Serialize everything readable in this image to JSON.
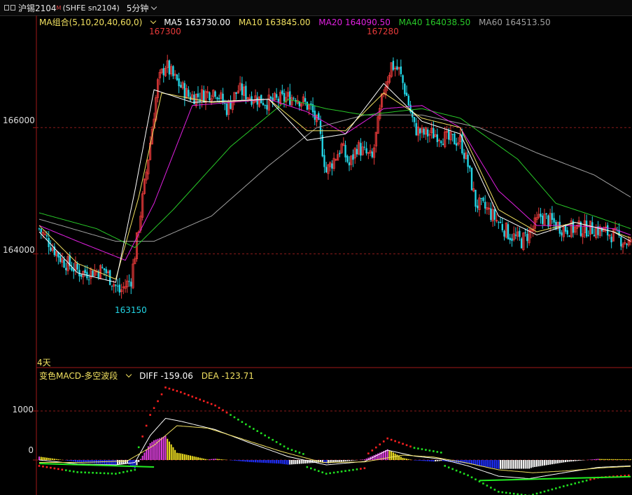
{
  "titlebar": {
    "symbol": "沪锡2104",
    "superscript": "M",
    "code": "(SHFE sn2104)",
    "period": "5分钟",
    "icon": "window-icon"
  },
  "main_legend": {
    "indicator": "MA组合(5,10,20,40,60,0)",
    "ma5": "MA5 163730.00",
    "ma10": "MA10 163845.00",
    "ma20": "MA20 164090.50",
    "ma40": "MA40 164038.50",
    "ma60": "MA60 164513.50"
  },
  "macd_legend": {
    "indicator": "变色MACD-多空波段",
    "diff": "DIFF -159.06",
    "dea": "DEA -123.71"
  },
  "annotations": {
    "high1": "167300",
    "high2": "167280",
    "low1": "163150",
    "days": "4天"
  },
  "colors": {
    "up": "#e83a3a",
    "down": "#22d6e6",
    "ma5": "#ffffff",
    "ma10": "#f0e060",
    "ma20": "#e020e0",
    "ma40": "#28c828",
    "ma60": "#a0a0a0",
    "grid": "#8b1a1a",
    "axis": "#a01818"
  },
  "chart_data": [
    {
      "type": "candlestick",
      "title": "",
      "y_ticks": [
        166000,
        164000
      ],
      "y_tick_labels": [
        "166000",
        "164000"
      ],
      "ylim": [
        162200,
        167600
      ],
      "ma_keypoints": {
        "ma5": [
          [
            0,
            164350
          ],
          [
            20,
            163700
          ],
          [
            40,
            163550
          ],
          [
            50,
            165000
          ],
          [
            60,
            166600
          ],
          [
            80,
            166400
          ],
          [
            120,
            166450
          ],
          [
            140,
            165800
          ],
          [
            160,
            165900
          ],
          [
            180,
            166700
          ],
          [
            200,
            166100
          ],
          [
            220,
            165900
          ],
          [
            240,
            164600
          ],
          [
            260,
            164300
          ],
          [
            280,
            164500
          ],
          [
            300,
            164350
          ],
          [
            309,
            164200
          ]
        ],
        "ma10": [
          [
            0,
            164450
          ],
          [
            20,
            163850
          ],
          [
            40,
            163600
          ],
          [
            52,
            164900
          ],
          [
            64,
            166550
          ],
          [
            90,
            166400
          ],
          [
            120,
            166450
          ],
          [
            140,
            165950
          ],
          [
            160,
            165950
          ],
          [
            180,
            166550
          ],
          [
            200,
            166150
          ],
          [
            220,
            166000
          ],
          [
            240,
            164700
          ],
          [
            260,
            164350
          ],
          [
            280,
            164500
          ],
          [
            300,
            164350
          ],
          [
            309,
            164250
          ]
        ],
        "ma20": [
          [
            0,
            164450
          ],
          [
            20,
            164200
          ],
          [
            45,
            163900
          ],
          [
            60,
            164800
          ],
          [
            80,
            166350
          ],
          [
            120,
            166450
          ],
          [
            140,
            166250
          ],
          [
            160,
            165900
          ],
          [
            180,
            166300
          ],
          [
            200,
            166350
          ],
          [
            220,
            166000
          ],
          [
            240,
            165000
          ],
          [
            260,
            164450
          ],
          [
            280,
            164450
          ],
          [
            300,
            164400
          ],
          [
            309,
            164300
          ]
        ],
        "ma40": [
          [
            0,
            164650
          ],
          [
            30,
            164400
          ],
          [
            50,
            164100
          ],
          [
            70,
            164700
          ],
          [
            100,
            165700
          ],
          [
            130,
            166450
          ],
          [
            150,
            166300
          ],
          [
            170,
            166200
          ],
          [
            200,
            166300
          ],
          [
            220,
            166150
          ],
          [
            250,
            165500
          ],
          [
            270,
            164800
          ],
          [
            290,
            164600
          ],
          [
            309,
            164400
          ]
        ],
        "ma60": [
          [
            0,
            164550
          ],
          [
            40,
            164200
          ],
          [
            60,
            164200
          ],
          [
            90,
            164600
          ],
          [
            120,
            165400
          ],
          [
            145,
            166000
          ],
          [
            170,
            166200
          ],
          [
            200,
            166200
          ],
          [
            230,
            166000
          ],
          [
            260,
            165600
          ],
          [
            290,
            165250
          ],
          [
            309,
            164900
          ]
        ]
      },
      "price_keypoints": [
        [
          0,
          164400
        ],
        [
          12,
          163900
        ],
        [
          22,
          163700
        ],
        [
          34,
          163750
        ],
        [
          42,
          163400
        ],
        [
          48,
          163600
        ],
        [
          50,
          164000
        ],
        [
          56,
          165300
        ],
        [
          62,
          166700
        ],
        [
          66,
          167000
        ],
        [
          70,
          166800
        ],
        [
          78,
          166500
        ],
        [
          84,
          166500
        ],
        [
          92,
          166600
        ],
        [
          98,
          166300
        ],
        [
          104,
          166600
        ],
        [
          110,
          166500
        ],
        [
          120,
          166400
        ],
        [
          134,
          166500
        ],
        [
          142,
          166300
        ],
        [
          146,
          166000
        ],
        [
          150,
          165300
        ],
        [
          154,
          165500
        ],
        [
          158,
          165700
        ],
        [
          162,
          165400
        ],
        [
          166,
          165700
        ],
        [
          170,
          165600
        ],
        [
          174,
          165500
        ],
        [
          180,
          166600
        ],
        [
          184,
          167000
        ],
        [
          188,
          166900
        ],
        [
          192,
          166500
        ],
        [
          196,
          166000
        ],
        [
          200,
          165900
        ],
        [
          208,
          165900
        ],
        [
          214,
          165800
        ],
        [
          220,
          165800
        ],
        [
          224,
          165400
        ],
        [
          228,
          164800
        ],
        [
          234,
          164700
        ],
        [
          240,
          164500
        ],
        [
          246,
          164300
        ],
        [
          252,
          164200
        ],
        [
          258,
          164400
        ],
        [
          262,
          164600
        ],
        [
          268,
          164500
        ],
        [
          274,
          164400
        ],
        [
          282,
          164400
        ],
        [
          290,
          164400
        ],
        [
          300,
          164300
        ],
        [
          309,
          164150
        ]
      ]
    },
    {
      "type": "bar",
      "title": "",
      "y_ticks": [
        1000,
        0
      ],
      "y_tick_labels": [
        "1000",
        "0"
      ],
      "ylim": [
        -700,
        1600
      ],
      "diff_keypoints": [
        [
          0,
          0
        ],
        [
          20,
          -80
        ],
        [
          40,
          -100
        ],
        [
          50,
          -50
        ],
        [
          58,
          500
        ],
        [
          66,
          850
        ],
        [
          74,
          790
        ],
        [
          92,
          620
        ],
        [
          110,
          350
        ],
        [
          130,
          70
        ],
        [
          150,
          -100
        ],
        [
          170,
          -30
        ],
        [
          182,
          200
        ],
        [
          196,
          80
        ],
        [
          210,
          20
        ],
        [
          224,
          -120
        ],
        [
          240,
          -330
        ],
        [
          256,
          -380
        ],
        [
          274,
          -260
        ],
        [
          292,
          -150
        ],
        [
          309,
          -120
        ]
      ],
      "dea_keypoints": [
        [
          0,
          -50
        ],
        [
          22,
          -50
        ],
        [
          46,
          -20
        ],
        [
          60,
          300
        ],
        [
          72,
          700
        ],
        [
          88,
          650
        ],
        [
          106,
          430
        ],
        [
          126,
          180
        ],
        [
          148,
          -50
        ],
        [
          170,
          -40
        ],
        [
          190,
          100
        ],
        [
          206,
          60
        ],
        [
          222,
          -50
        ],
        [
          240,
          -200
        ],
        [
          258,
          -260
        ],
        [
          276,
          -220
        ],
        [
          294,
          -160
        ],
        [
          309,
          -130
        ]
      ]
    }
  ]
}
